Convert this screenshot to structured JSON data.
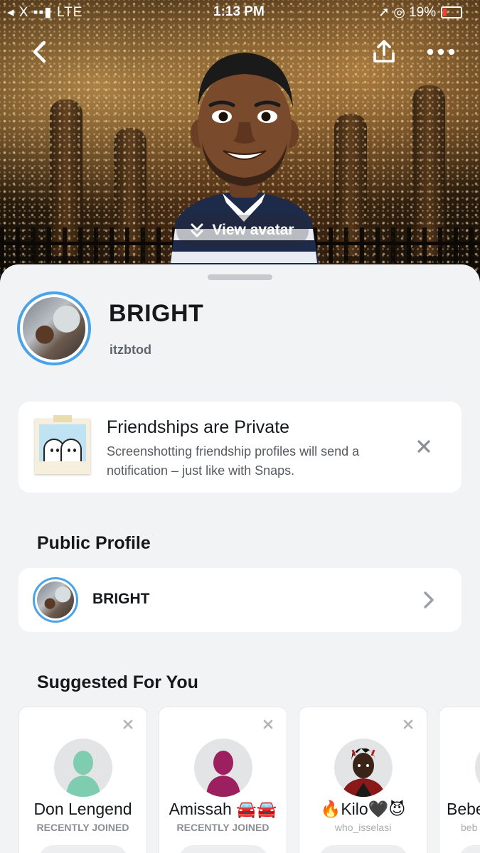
{
  "status_bar": {
    "carrier": "◂ X ▪▪▮ LTE",
    "time": "1:13 PM",
    "right": "➚ ◎ 19%"
  },
  "hero": {
    "view_avatar_label": "View avatar"
  },
  "profile": {
    "display_name": "BRIGHT",
    "username": "itzbtod"
  },
  "privacy_notice": {
    "title": "Friendships are Private",
    "description": "Screenshotting friendship profiles will send a notification – just like with Snaps."
  },
  "public_profile": {
    "section_title": "Public Profile",
    "name": "BRIGHT"
  },
  "suggested": {
    "section_title": "Suggested For You",
    "cards": [
      {
        "name": "Don Lengend",
        "subtitle": "RECENTLY JOINED",
        "avatar_color": "#7fcdb0"
      },
      {
        "name": "Amissah 🚘🚘",
        "subtitle": "RECENTLY JOINED",
        "avatar_color": "#9c1f5f"
      },
      {
        "name": "🔥Kilo🖤😈",
        "subtitle": "who_isselasi",
        "avatar_color": "#3a2a22"
      },
      {
        "name": "Bebe",
        "subtitle": "beb",
        "avatar_color": "#e3e4e6"
      }
    ]
  },
  "colors": {
    "accent_ring": "#4aa3e8",
    "sheet_background": "#f2f3f5",
    "battery_low": "#ff3b30"
  }
}
